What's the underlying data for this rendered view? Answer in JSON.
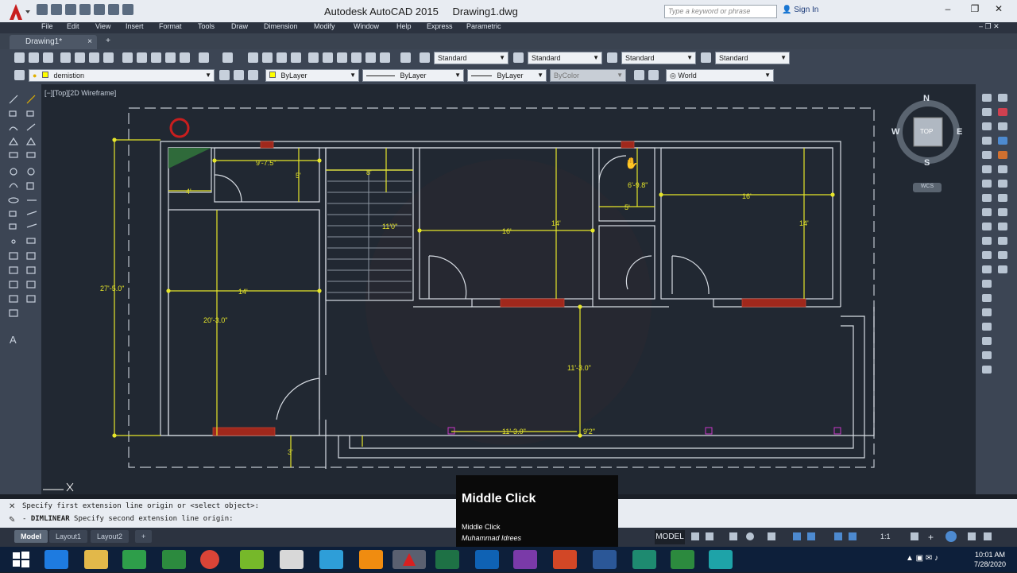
{
  "titlebar": {
    "app_name": "Autodesk AutoCAD 2015",
    "file_name": "Drawing1.dwg",
    "search_placeholder": "Type a keyword or phrase",
    "sign_in": "Sign In"
  },
  "menu": [
    "File",
    "Edit",
    "View",
    "Insert",
    "Format",
    "Tools",
    "Draw",
    "Dimension",
    "Modify",
    "Window",
    "Help",
    "Express",
    "Parametric"
  ],
  "file_tab": "Drawing1*",
  "toolbar": {
    "text_style": "Standard",
    "dim_style": "Standard",
    "table_style": "Standard",
    "mleader_style": "Standard",
    "layer": "demistion",
    "color": "ByLayer",
    "linetype": "ByLayer",
    "lineweight": "ByLayer",
    "plotstyle": "ByColor",
    "ucs": "World"
  },
  "viewport_label": "[−][Top][2D Wireframe]",
  "viewcube": {
    "north": "N",
    "south": "S",
    "east": "E",
    "west": "W",
    "top": "TOP",
    "wcs": "WCS"
  },
  "dimensions": {
    "d1": "9'-7.5\"",
    "d2": "5'",
    "d3": "4'",
    "d4": "8'",
    "d5": "11'0\"",
    "d6": "16'",
    "d7": "14'",
    "d8": "6'-9.8\"",
    "d9": "5'",
    "d10": "16'",
    "d11": "14'",
    "d12": "27'-5.0\"",
    "d13": "14'",
    "d14": "20'-3.0\"",
    "d15": "11'-3.0\"",
    "d16": "11'-3.0\"",
    "d17": "9'2\"",
    "d18": "3'"
  },
  "command": {
    "history": "Specify first extension line origin or <select object>:",
    "prompt_cmd": "DIMLINEAR",
    "prompt_text": "Specify second extension line origin:"
  },
  "layout_tabs": [
    "Model",
    "Layout1",
    "Layout2"
  ],
  "status": {
    "model": "MODEL",
    "scale": "1:1"
  },
  "overlay": {
    "title": "Middle Click",
    "subtitle": "Middle Click",
    "author": "Muhammad Idrees"
  },
  "clock": {
    "time": "10:01 AM",
    "date": "7/28/2020"
  }
}
